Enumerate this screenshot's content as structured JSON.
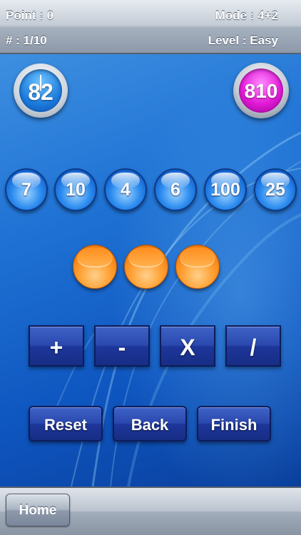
{
  "header": {
    "point_label": "Point : 0",
    "mode_label": "Mode : 4+2",
    "progress_label": "# : 1/10",
    "level_label": "Level : Easy"
  },
  "timer": {
    "value": "82"
  },
  "target": {
    "value": "810"
  },
  "numbers": [
    "7",
    "10",
    "4",
    "6",
    "100",
    "25"
  ],
  "slots": [
    "",
    "",
    ""
  ],
  "operators": [
    "+",
    "-",
    "X",
    "/"
  ],
  "actions": {
    "reset": "Reset",
    "back": "Back",
    "finish": "Finish"
  },
  "footer": {
    "home": "Home"
  },
  "colors": {
    "number_ball": "#2f8ef0",
    "slot_ball": "#ff9d2e",
    "target_ball": "#e21ad8",
    "button": "#2a48ad"
  }
}
